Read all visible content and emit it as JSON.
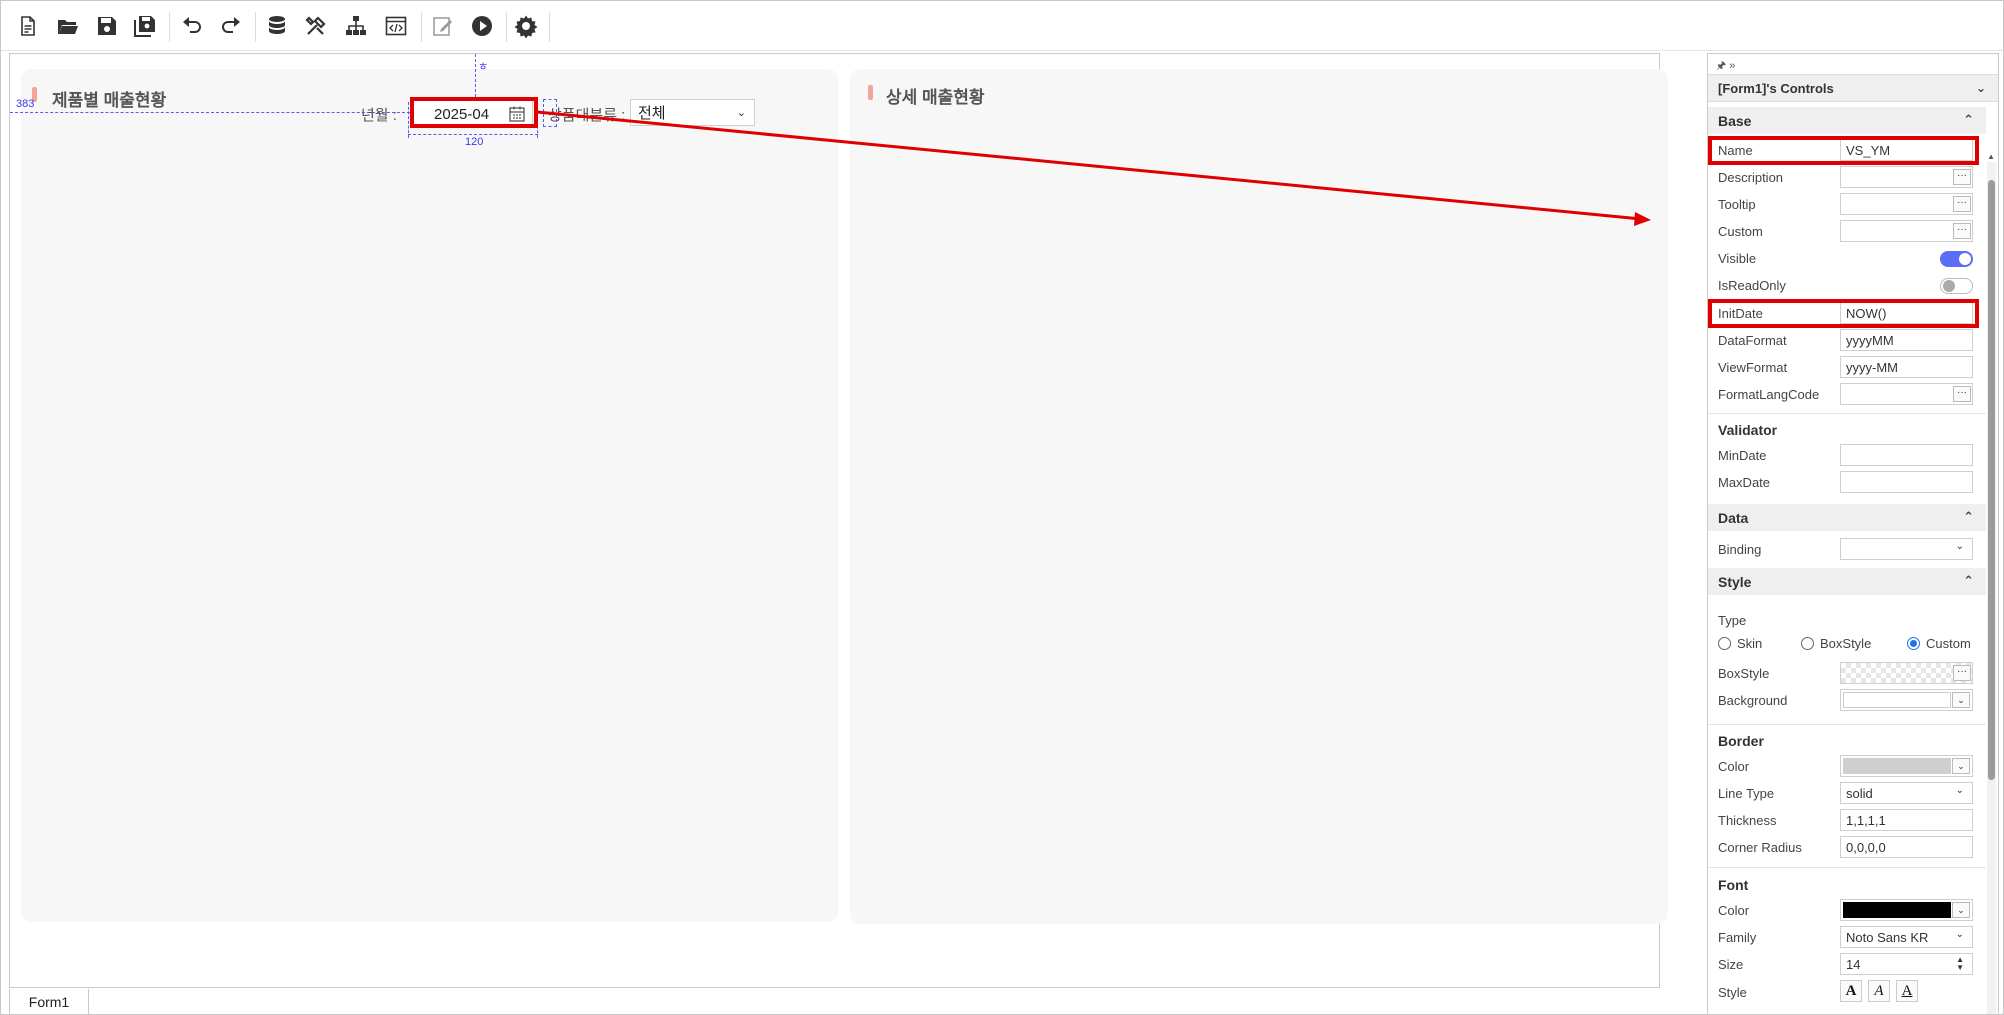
{
  "toolbar": {
    "buttons": [
      "new-file-icon",
      "open-folder-icon",
      "save-icon",
      "save-all-icon",
      "undo-icon",
      "redo-icon",
      "database-icon",
      "tools-icon",
      "hierarchy-icon",
      "code-window-icon",
      "edit-icon",
      "run-icon",
      "settings-icon"
    ]
  },
  "canvas": {
    "left_panel_title": "제품별 매출현황",
    "right_panel_title": "상세 매출현황",
    "year_month_label": "년월 :",
    "date_value": "2025-04",
    "category_label": "상품대분류 :",
    "category_value": "전체",
    "guide_top_value": "383",
    "guide_width_value": "120",
    "guide_top_glyph": "ㅎ"
  },
  "bottom_tab": {
    "label": "Form1"
  },
  "properties": {
    "pin_glyph": "🖈 »",
    "header": "[Form1]'s Controls",
    "base": {
      "title": "Base",
      "name_label": "Name",
      "name_value": "VS_YM",
      "description_label": "Description",
      "tooltip_label": "Tooltip",
      "custom_label": "Custom",
      "visible_label": "Visible",
      "visible_on": true,
      "readonly_label": "IsReadOnly",
      "readonly_on": false,
      "initdate_label": "InitDate",
      "initdate_value": "NOW()",
      "dataformat_label": "DataFormat",
      "dataformat_value": "yyyyMM",
      "viewformat_label": "ViewFormat",
      "viewformat_value": "yyyy-MM",
      "formatlang_label": "FormatLangCode"
    },
    "validator": {
      "title": "Validator",
      "mindate_label": "MinDate",
      "maxdate_label": "MaxDate"
    },
    "data": {
      "title": "Data",
      "binding_label": "Binding"
    },
    "style": {
      "title": "Style",
      "type_label": "Type",
      "radio_skin": "Skin",
      "radio_boxstyle": "BoxStyle",
      "radio_custom": "Custom",
      "selected": "Custom",
      "boxstyle_label": "BoxStyle",
      "background_label": "Background"
    },
    "border": {
      "title": "Border",
      "color_label": "Color",
      "color_value": "#cfcfcf",
      "linetype_label": "Line Type",
      "linetype_value": "solid",
      "thickness_label": "Thickness",
      "thickness_value": "1,1,1,1",
      "radius_label": "Corner Radius",
      "radius_value": "0,0,0,0"
    },
    "font": {
      "title": "Font",
      "color_label": "Color",
      "color_value": "#000000",
      "family_label": "Family",
      "family_value": "Noto Sans KR",
      "size_label": "Size",
      "size_value": "14",
      "style_label": "Style"
    }
  },
  "colors": {
    "highlight": "#e00000",
    "accent": "#5b6ef5",
    "guide": "#5b5bf0"
  }
}
